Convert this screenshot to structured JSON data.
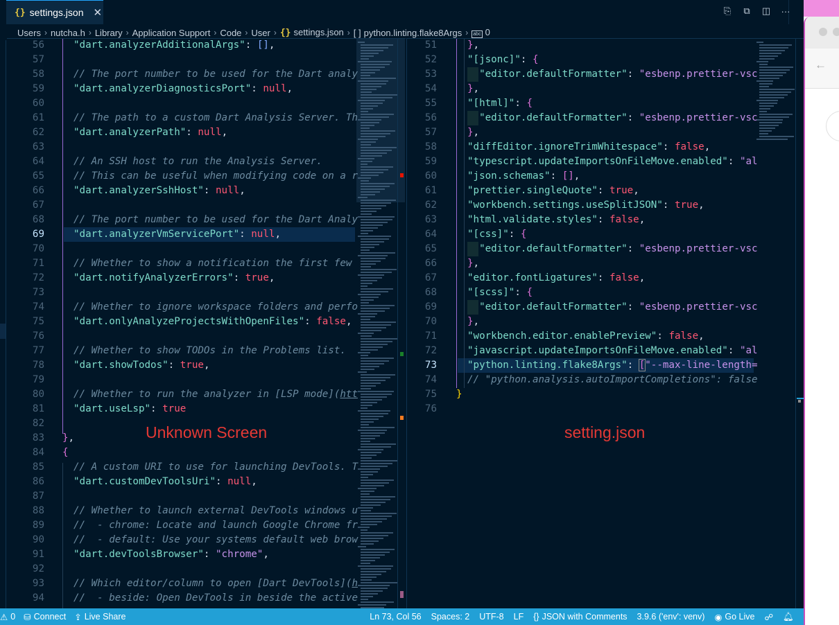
{
  "tab": {
    "label": "settings.json",
    "icon": "json-braces-icon",
    "close_icon": "close-icon"
  },
  "editor_actions": [
    {
      "name": "open-changes-icon",
      "glyph": "⎘"
    },
    {
      "name": "open-preview-icon",
      "glyph": "⧉"
    },
    {
      "name": "split-editor-icon",
      "glyph": "◫"
    },
    {
      "name": "more-actions-icon",
      "glyph": "···"
    }
  ],
  "breadcrumb": {
    "items": [
      "Users",
      "nutcha.h",
      "Library",
      "Application Support",
      "Code",
      "User",
      "settings.json",
      "python.linting.flake8Args",
      "0"
    ],
    "separator": "›"
  },
  "left_pane": {
    "lines": [
      {
        "n": "56",
        "html": "<span class='key'>\"dart.analyzerAdditionalArgs\"</span><span class='punc'>: </span><span class='brk'>[]</span><span class='punc'>,</span>"
      },
      {
        "n": "57",
        "html": ""
      },
      {
        "n": "58",
        "html": "<span class='cmt'>// The port number to be used for the Dart analy</span>"
      },
      {
        "n": "59",
        "html": "<span class='key'>\"dart.analyzerDiagnosticsPort\"</span><span class='punc'>: </span><span class='null'>null</span><span class='punc'>,</span>"
      },
      {
        "n": "60",
        "html": ""
      },
      {
        "n": "61",
        "html": "<span class='cmt'>// The path to a custom Dart Analysis Server. Th</span>"
      },
      {
        "n": "62",
        "html": "<span class='key'>\"dart.analyzerPath\"</span><span class='punc'>: </span><span class='null'>null</span><span class='punc'>,</span>"
      },
      {
        "n": "63",
        "html": ""
      },
      {
        "n": "64",
        "html": "<span class='cmt'>// An SSH host to run the Analysis Server.</span>"
      },
      {
        "n": "65",
        "html": "<span class='cmt'>// This can be useful when modifying code on a r</span>"
      },
      {
        "n": "66",
        "html": "<span class='key'>\"dart.analyzerSshHost\"</span><span class='punc'>: </span><span class='null'>null</span><span class='punc'>,</span>"
      },
      {
        "n": "67",
        "html": ""
      },
      {
        "n": "68",
        "html": "<span class='cmt'>// The port number to be used for the Dart Analy</span>"
      },
      {
        "n": "69",
        "html": "<span class='key'>\"dart.analyzerVmServicePort\"</span><span class='punc'>: </span><span class='null'>null</span><span class='punc'>,</span>",
        "active": true
      },
      {
        "n": "70",
        "html": ""
      },
      {
        "n": "71",
        "html": "<span class='cmt'>// Whether to show a notification the first few</span>"
      },
      {
        "n": "72",
        "html": "<span class='key'>\"dart.notifyAnalyzerErrors\"</span><span class='punc'>: </span><span class='bool'>true</span><span class='punc'>,</span>"
      },
      {
        "n": "73",
        "html": ""
      },
      {
        "n": "74",
        "html": "<span class='cmt'>// Whether to ignore workspace folders and perfo</span>"
      },
      {
        "n": "75",
        "html": "<span class='key'>\"dart.onlyAnalyzeProjectsWithOpenFiles\"</span><span class='punc'>: </span><span class='bool'>false</span><span class='punc'>,</span>"
      },
      {
        "n": "76",
        "html": ""
      },
      {
        "n": "77",
        "html": "<span class='cmt'>// Whether to show TODOs in the Problems list.</span>"
      },
      {
        "n": "78",
        "html": "<span class='key'>\"dart.showTodos\"</span><span class='punc'>: </span><span class='bool'>true</span><span class='punc'>,</span>"
      },
      {
        "n": "79",
        "html": ""
      },
      {
        "n": "80",
        "html": "<span class='cmt'>// Whether to run the analyzer in [LSP mode](<span class='link'>htt</span></span>"
      },
      {
        "n": "81",
        "html": "<span class='key'>\"dart.useLsp\"</span><span class='punc'>: </span><span class='bool'>true</span>"
      },
      {
        "n": "82",
        "html": ""
      },
      {
        "n": "83",
        "html": "<span class='brace2'>}</span><span class='punc'>,</span>",
        "outdent": true
      },
      {
        "n": "84",
        "html": "<span class='brace2'>{</span>",
        "outdent": true
      },
      {
        "n": "85",
        "html": "<span class='cmt'>// A custom URI to use for launching DevTools. T</span>"
      },
      {
        "n": "86",
        "html": "<span class='key'>\"dart.customDevToolsUri\"</span><span class='punc'>: </span><span class='null'>null</span><span class='punc'>,</span>"
      },
      {
        "n": "87",
        "html": ""
      },
      {
        "n": "88",
        "html": "<span class='cmt'>// Whether to launch external DevTools windows u</span>"
      },
      {
        "n": "89",
        "html": "<span class='cmt'>//  - chrome: Locate and launch Google Chrome fr</span>"
      },
      {
        "n": "90",
        "html": "<span class='cmt'>//  - default: Use your systems default web brow</span>"
      },
      {
        "n": "91",
        "html": "<span class='key'>\"dart.devToolsBrowser\"</span><span class='punc'>: </span><span class='str'>\"chrome\"</span><span class='punc'>,</span>"
      },
      {
        "n": "92",
        "html": ""
      },
      {
        "n": "93",
        "html": "<span class='cmt'>// Which editor/column to open [Dart DevTools](<span class='link'>h</span></span>"
      },
      {
        "n": "94",
        "html": "<span class='cmt'>//  - beside: Open DevTools in beside the active</span>"
      }
    ],
    "annotation": "Unknown Screen"
  },
  "right_pane": {
    "lines": [
      {
        "n": "51",
        "html": "<span class='brace2'>}</span><span class='punc'>,</span>"
      },
      {
        "n": "52",
        "html": "<span class='key'>\"[jsonc]\"</span><span class='punc'>: </span><span class='brace2'>{</span>"
      },
      {
        "n": "53",
        "html": "  <span class='key'>\"editor.defaultFormatter\"</span><span class='punc'>: </span><span class='str'>\"esbenp.prettier-vsc</span>",
        "ws": true
      },
      {
        "n": "54",
        "html": "<span class='brace2'>}</span><span class='punc'>,</span>"
      },
      {
        "n": "55",
        "html": "<span class='key'>\"[html]\"</span><span class='punc'>: </span><span class='brace2'>{</span>"
      },
      {
        "n": "56",
        "html": "  <span class='key'>\"editor.defaultFormatter\"</span><span class='punc'>: </span><span class='str'>\"esbenp.prettier-vsc</span>",
        "ws": true
      },
      {
        "n": "57",
        "html": "<span class='brace2'>}</span><span class='punc'>,</span>"
      },
      {
        "n": "58",
        "html": "<span class='key'>\"diffEditor.ignoreTrimWhitespace\"</span><span class='punc'>: </span><span class='bool'>false</span><span class='punc'>,</span>"
      },
      {
        "n": "59",
        "html": "<span class='key'>\"typescript.updateImportsOnFileMove.enabled\"</span><span class='punc'>: </span><span class='str'>\"al</span>"
      },
      {
        "n": "60",
        "html": "<span class='key'>\"json.schemas\"</span><span class='punc'>: </span><span class='brace2'>[]</span><span class='punc'>,</span>"
      },
      {
        "n": "61",
        "html": "<span class='key'>\"prettier.singleQuote\"</span><span class='punc'>: </span><span class='bool'>true</span><span class='punc'>,</span>"
      },
      {
        "n": "62",
        "html": "<span class='key'>\"workbench.settings.useSplitJSON\"</span><span class='punc'>: </span><span class='bool'>true</span><span class='punc'>,</span>"
      },
      {
        "n": "63",
        "html": "<span class='key'>\"html.validate.styles\"</span><span class='punc'>: </span><span class='bool'>false</span><span class='punc'>,</span>"
      },
      {
        "n": "64",
        "html": "<span class='key'>\"[css]\"</span><span class='punc'>: </span><span class='brace2'>{</span>"
      },
      {
        "n": "65",
        "html": "  <span class='key'>\"editor.defaultFormatter\"</span><span class='punc'>: </span><span class='str'>\"esbenp.prettier-vsc</span>",
        "ws": true
      },
      {
        "n": "66",
        "html": "<span class='brace2'>}</span><span class='punc'>,</span>"
      },
      {
        "n": "67",
        "html": "<span class='key'>\"editor.fontLigatures\"</span><span class='punc'>: </span><span class='bool'>false</span><span class='punc'>,</span>"
      },
      {
        "n": "68",
        "html": "<span class='key'>\"[scss]\"</span><span class='punc'>: </span><span class='brace2'>{</span>"
      },
      {
        "n": "69",
        "html": "  <span class='key'>\"editor.defaultFormatter\"</span><span class='punc'>: </span><span class='str'>\"esbenp.prettier-vsc</span>",
        "ws": true
      },
      {
        "n": "70",
        "html": "<span class='brace2'>}</span><span class='punc'>,</span>"
      },
      {
        "n": "71",
        "html": "<span class='key'>\"workbench.editor.enablePreview\"</span><span class='punc'>: </span><span class='bool'>false</span><span class='punc'>,</span>"
      },
      {
        "n": "72",
        "html": "<span class='key'>\"javascript.updateImportsOnFileMove.enabled\"</span><span class='punc'>: </span><span class='str'>\"al</span>"
      },
      {
        "n": "73",
        "html": "<span class='key'>\"python.linting.flake8Args\"</span><span class='punc'>: </span><span class='brace2' style='outline:1px solid #888;'>[</span><span class='str'>\"--max-line-length=</span>",
        "active": true
      },
      {
        "n": "74",
        "html": "<span class='cmt'>// \"python.analysis.autoImportCompletions\": false</span>"
      },
      {
        "n": "75",
        "html": "<span class='brace1'>}</span>",
        "outdent": true
      },
      {
        "n": "76",
        "html": "",
        "outdent": true
      }
    ],
    "annotation": "setting.json"
  },
  "statusbar": {
    "left": [
      {
        "name": "problems",
        "icon": "warning-icon",
        "glyph": "⚠",
        "label": "0"
      },
      {
        "name": "connect",
        "icon": "database-icon",
        "glyph": "⛁",
        "label": "Connect"
      },
      {
        "name": "live-share",
        "icon": "live-share-icon",
        "glyph": "⇪",
        "label": "Live Share"
      }
    ],
    "right": [
      {
        "name": "cursor-position",
        "label": "Ln 73, Col 56"
      },
      {
        "name": "indentation",
        "label": "Spaces: 2"
      },
      {
        "name": "encoding",
        "label": "UTF-8"
      },
      {
        "name": "eol",
        "label": "LF"
      },
      {
        "name": "language-mode",
        "icon": "braces-icon",
        "glyph": "{}",
        "label": "JSON with Comments"
      },
      {
        "name": "python-interpreter",
        "label": "3.9.6 ('env': venv)"
      },
      {
        "name": "go-live",
        "icon": "broadcast-icon",
        "glyph": "◉",
        "label": "Go Live"
      },
      {
        "name": "feedback",
        "icon": "feedback-icon",
        "glyph": "☍",
        "label": ""
      },
      {
        "name": "notifications",
        "icon": "bell-icon",
        "glyph": "🔔︎",
        "label": ""
      }
    ]
  },
  "colors": {
    "statusbar_bg": "#22a0d6",
    "editor_bg": "#011627",
    "annotation": "#e53935",
    "browser_menubar": "#f08ee0"
  }
}
